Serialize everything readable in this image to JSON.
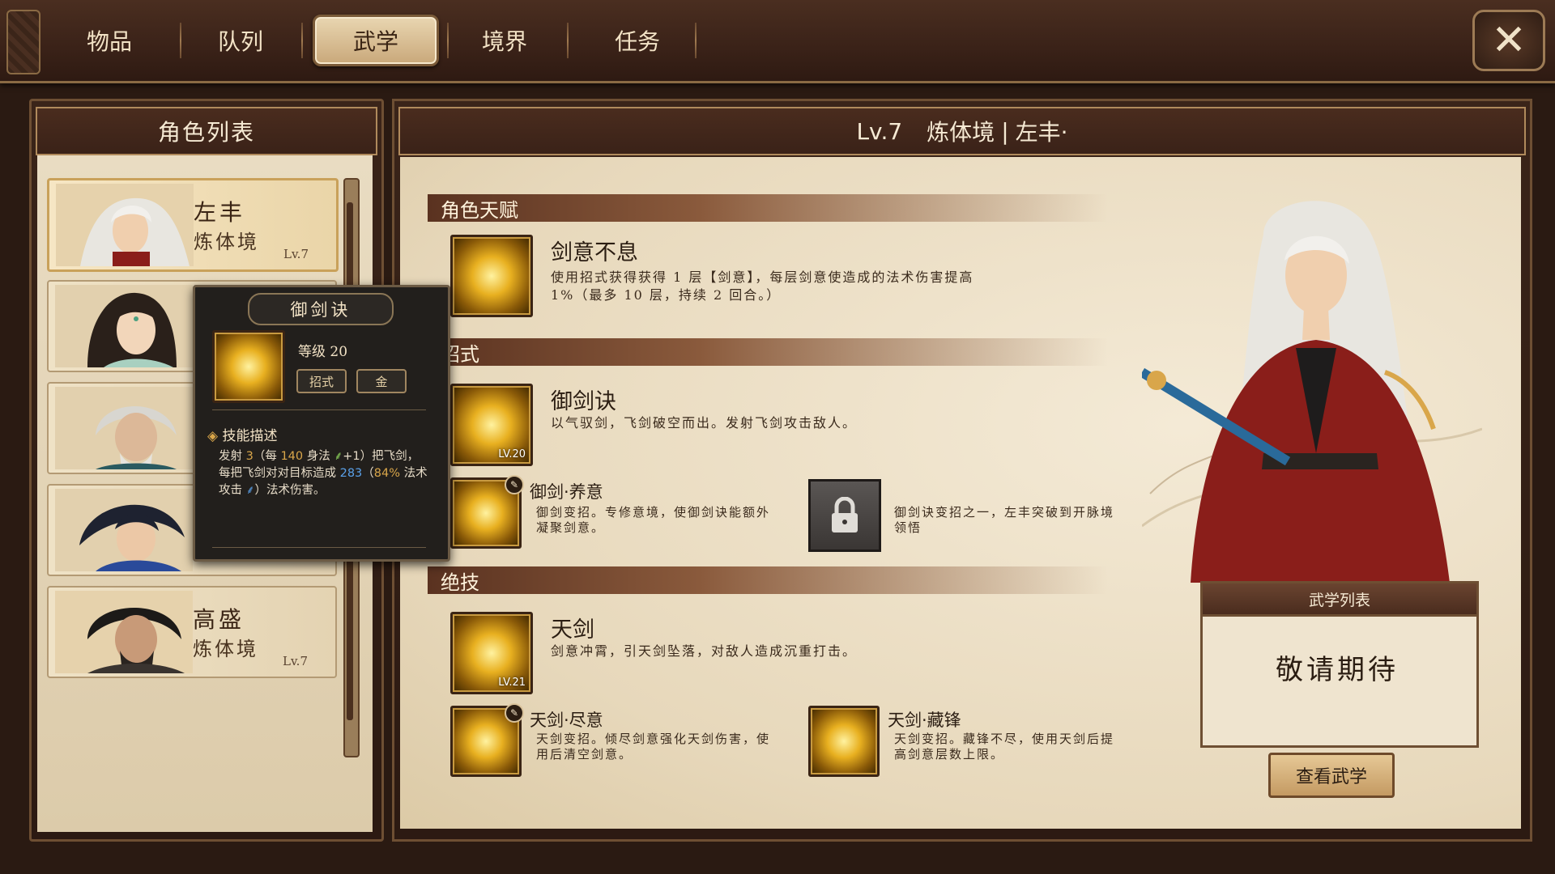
{
  "tabs": [
    {
      "label": "物品"
    },
    {
      "label": "队列"
    },
    {
      "label": "武学"
    },
    {
      "label": "境界"
    },
    {
      "label": "任务"
    }
  ],
  "left_panel": {
    "title": "角色列表",
    "roles": [
      {
        "name": "左丰",
        "realm": "炼体境",
        "level": "Lv.7"
      },
      {
        "name": "",
        "realm": "",
        "level": ""
      },
      {
        "name": "",
        "realm": "",
        "level": ""
      },
      {
        "name": "",
        "realm": "",
        "level": ""
      },
      {
        "name": "高盛",
        "realm": "炼体境",
        "level": "Lv.7"
      }
    ]
  },
  "header": {
    "level": "Lv.7",
    "realm": "炼体境",
    "separator": "|",
    "name": "左丰·"
  },
  "talent": {
    "section": "角色天赋",
    "name": "剑意不息",
    "desc_line1": "使用招式获得获得 1 层【剑意】，每层剑意使造成的法术伤害提高",
    "desc_line2": "1%（最多 10 层，持续 2 回合。）"
  },
  "moves": {
    "section": "招式",
    "skill": {
      "name": "御剑诀",
      "level": "LV.20",
      "desc": "以气驭剑，飞剑破空而出。发射飞剑攻击敌人。"
    },
    "variant1": {
      "name": "御剑·养意",
      "desc_line1": "御剑变招。专修意境，使御剑诀能额外",
      "desc_line2": "凝聚剑意。"
    },
    "variant2": {
      "desc_line1": "御剑诀变招之一，左丰突破到开脉境",
      "desc_line2": "领悟"
    }
  },
  "ultimate": {
    "section": "绝技",
    "skill": {
      "name": "天剑",
      "level": "LV.21",
      "desc": "剑意冲霄，引天剑坠落，对敌人造成沉重打击。"
    },
    "variant1": {
      "name": "天剑·尽意",
      "desc_line1": "天剑变招。倾尽剑意强化天剑伤害，使",
      "desc_line2": "用后清空剑意。"
    },
    "variant2": {
      "name": "天剑·藏锋",
      "desc_line1": "天剑变招。藏锋不尽，使用天剑后提",
      "desc_line2": "高剑意层数上限。"
    }
  },
  "wuxue_list": {
    "title": "武学列表",
    "placeholder": "敬请期待",
    "button": "查看武学"
  },
  "tooltip": {
    "title": "御剑诀",
    "level_label": "等级 20",
    "tag1": "招式",
    "tag2": "金",
    "desc_heading": "技能描述",
    "desc_parts": {
      "p1": "发射 ",
      "count": "3",
      "p2": "（每 ",
      "per": "140",
      "p3": " 身法 ",
      "p4": "+1）把飞剑，每把飞剑对对目标造成 ",
      "dmg": "283",
      "p5": "（",
      "pct": "84%",
      "p6": " 法术攻击 ",
      "p7": "）法术伤害。"
    }
  },
  "colors": {
    "accent_gold": "#d9a64a",
    "frame_brown": "#6e4f33",
    "parchment": "#efe4cf",
    "robe_red": "#8a1e1a"
  }
}
